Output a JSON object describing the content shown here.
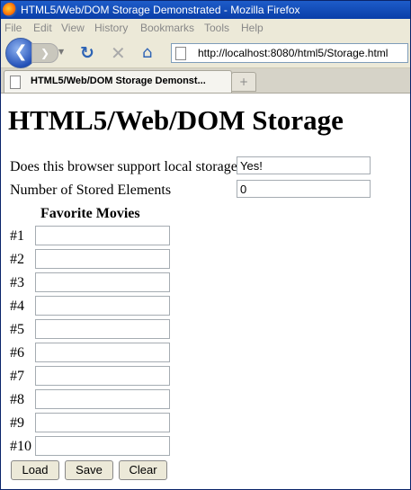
{
  "window": {
    "title": "HTML5/Web/DOM Storage Demonstrated - Mozilla Firefox"
  },
  "menu": {
    "items": [
      "File",
      "Edit",
      "View",
      "History",
      "Bookmarks",
      "Tools",
      "Help"
    ]
  },
  "nav": {
    "url": "http://localhost:8080/html5/Storage.html"
  },
  "tabs": [
    {
      "label": "HTML5/Web/DOM Storage Demonst..."
    }
  ],
  "page": {
    "heading": "HTML5/Web/DOM Storage",
    "support_label": "Does this browser support local storage?",
    "support_value": "Yes!",
    "count_label": "Number of Stored Elements",
    "count_value": "0",
    "movies_heading": "Favorite Movies",
    "movie_labels": [
      "#1",
      "#2",
      "#3",
      "#4",
      "#5",
      "#6",
      "#7",
      "#8",
      "#9",
      "#10"
    ],
    "buttons": {
      "load": "Load",
      "save": "Save",
      "clear": "Clear"
    }
  }
}
